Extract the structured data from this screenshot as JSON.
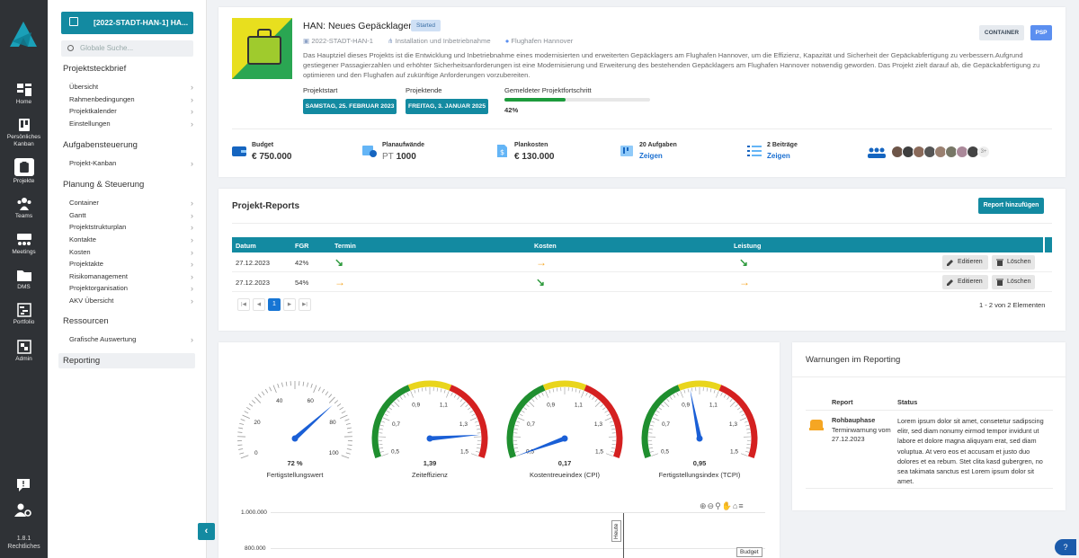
{
  "rail": {
    "items": [
      {
        "label": "Home",
        "icon": "grid-icon"
      },
      {
        "label": "Persönliches Kanban",
        "icon": "kanban-icon"
      },
      {
        "label": "Projekte",
        "icon": "project-icon"
      },
      {
        "label": "Teams",
        "icon": "teams-icon"
      },
      {
        "label": "Meetings",
        "icon": "meetings-icon"
      },
      {
        "label": "DMS",
        "icon": "folder-icon"
      },
      {
        "label": "Portfolio",
        "icon": "portfolio-icon"
      },
      {
        "label": "Admin",
        "icon": "admin-icon"
      }
    ],
    "version": "1.8.1",
    "legal": "Rechtliches"
  },
  "sidebar": {
    "project_button": "[2022-STADT-HAN-1] HA...",
    "search_placeholder": "Globale Suche...",
    "sections": [
      {
        "title": "Projektsteckbrief",
        "items": [
          "Übersicht",
          "Rahmenbedingungen",
          "Projektkalender",
          "Einstellungen"
        ]
      },
      {
        "title": "Aufgabensteuerung",
        "items": [
          "Projekt-Kanban"
        ]
      },
      {
        "title": "Planung & Steuerung",
        "items": [
          "Container",
          "Gantt",
          "Projektstrukturplan",
          "Kontakte",
          "Kosten",
          "Projektakte",
          "Risikomanagement",
          "Projektorganisation",
          "AKV Übersicht"
        ]
      },
      {
        "title": "Ressourcen",
        "items": [
          "Grafische Auswertung"
        ]
      }
    ],
    "reporting": "Reporting"
  },
  "project": {
    "title": "HAN: Neues Gepäcklager",
    "status": "Started",
    "code": "2022-STADT-HAN-1",
    "category": "Installation und Inbetriebnahme",
    "client": "Flughafen Hannover",
    "description": "Das Hauptziel dieses Projekts ist die Entwicklung und Inbetriebnahme eines modernisierten und erweiterten Gepäcklagers am Flughafen Hannover, um die Effizienz, Kapazität und Sicherheit der Gepäckabfertigung zu verbessern.Aufgrund gestiegener Passagierzahlen und erhöhter Sicherheitsanforderungen ist eine Modernisierung und Erweiterung des bestehenden Gepäcklagers am Flughafen Hannover notwendig geworden. Das Projekt zielt darauf ab, die Gepäckabfertigung zu optimieren und den Flughafen auf zukünftige Anforderungen vorzubereiten.",
    "btn_container": "CONTAINER",
    "btn_psp": "PSP",
    "start_label": "Projektstart",
    "start_date": "SAMSTAG, 25. FEBRUAR 2023",
    "end_label": "Projektende",
    "end_date": "FREITAG, 3. JANUAR 2025",
    "progress_label": "Gemeldeter Projektfortschritt",
    "progress_value": 42,
    "progress_text": "42%",
    "stats": {
      "budget_label": "Budget",
      "budget_cur": "€",
      "budget_value": "750.000",
      "plan_label": "Planaufwände",
      "plan_unit": "PT",
      "plan_value": "1000",
      "cost_label": "Plankosten",
      "cost_cur": "€",
      "cost_value": "130.000",
      "tasks_label": "20 Aufgaben",
      "tasks_link": "Zeigen",
      "posts_label": "2 Beiträge",
      "posts_link": "Zeigen",
      "members_more": "3+"
    },
    "colors": {
      "accent": "#138aa1",
      "progress": "#1d9b3c"
    }
  },
  "reports": {
    "title": "Projekt-Reports",
    "add_button": "Report hinzufügen",
    "columns": [
      "Datum",
      "FGR",
      "Termin",
      "Kosten",
      "Leistung"
    ],
    "rows": [
      {
        "date": "27.12.2023",
        "fgr": "42%",
        "termin": "green",
        "kosten": "orange",
        "leistung": "green"
      },
      {
        "date": "27.12.2023",
        "fgr": "54%",
        "termin": "orange",
        "kosten": "green",
        "leistung": "orange"
      }
    ],
    "edit": "Editieren",
    "delete": "Löschen",
    "page": "1",
    "count_text": "1 - 2 von 2 Elementen"
  },
  "gauges": [
    {
      "value_text": "72 %",
      "label": "Fertigstellungswert",
      "value": 72,
      "min": 0,
      "max": 100,
      "ticks": [
        "0",
        "20",
        "40",
        "60",
        "80",
        "100"
      ]
    },
    {
      "value_text": "1,39",
      "label": "Zeiteffizienz",
      "value": 1.39,
      "min": 0.5,
      "max": 1.5,
      "ticks": [
        "0,5",
        "0,7",
        "0,9",
        "1,1",
        "1,3",
        "1,5"
      ]
    },
    {
      "value_text": "0,17",
      "label": "Kostentreueindex (CPI)",
      "value": 0.17,
      "min": 0.5,
      "max": 1.5,
      "ticks": [
        "0,5",
        "0,7",
        "0,9",
        "1,1",
        "1,3",
        "1,5"
      ]
    },
    {
      "value_text": "0,95",
      "label": "Fertigstellungsindex (TCPI)",
      "value": 0.95,
      "min": 0.5,
      "max": 1.5,
      "ticks": [
        "0,5",
        "0,7",
        "0,9",
        "1,1",
        "1,3",
        "1,5"
      ]
    }
  ],
  "line_chart": {
    "y_ticks": [
      "1.000.000",
      "800.000"
    ],
    "marker_today": "Heute",
    "series_label": "Budget"
  },
  "warnings": {
    "title": "Warnungen im Reporting",
    "col_report": "Report",
    "col_status": "Status",
    "item_name": "Rohbauphase",
    "item_type": "Terminwarnung vom 27.12.2023",
    "item_text": "Lorem ipsum dolor sit amet, consetetur sadipscing elitr, sed diam nonumy eirmod tempor invidunt ut labore et dolore magna aliquyam erat, sed diam voluptua. At vero eos et accusam et justo duo dolores et ea rebum. Stet clita kasd gubergren, no sea takimata sanctus est Lorem ipsum dolor sit amet."
  }
}
